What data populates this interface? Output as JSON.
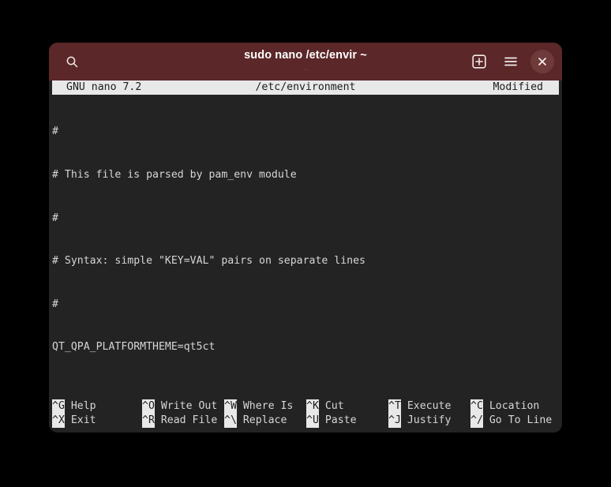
{
  "window": {
    "titlebar": {
      "search_icon": "search-icon",
      "title": "sudo nano /etc/envir ~",
      "subtitle": "~",
      "new_tab_icon": "new-tab-icon",
      "menu_icon": "hamburger-menu-icon",
      "close_icon": "close-icon"
    },
    "colors": {
      "titlebar_bg": "#5b2728",
      "terminal_bg": "#232323",
      "terminal_fg": "#d6d6d6",
      "reverse_bg": "#e8e8e8",
      "reverse_fg": "#1c1c1c",
      "page_bg": "#000000",
      "close_btn_bg": "#6f3a3a"
    }
  },
  "nano": {
    "status_bar": {
      "version": "GNU nano 7.2",
      "filename": "/etc/environment",
      "state": "Modified"
    },
    "buffer": [
      "#",
      "# This file is parsed by pam_env module",
      "#",
      "# Syntax: simple \"KEY=VAL\" pairs on separate lines",
      "#",
      "QT_QPA_PLATFORMTHEME=qt5ct"
    ],
    "shortcuts": {
      "row1": [
        {
          "key": "^G",
          "label": "Help"
        },
        {
          "key": "^O",
          "label": "Write Out"
        },
        {
          "key": "^W",
          "label": "Where Is"
        },
        {
          "key": "^K",
          "label": "Cut"
        },
        {
          "key": "^T",
          "label": "Execute"
        },
        {
          "key": "^C",
          "label": "Location"
        }
      ],
      "row2": [
        {
          "key": "^X",
          "label": "Exit"
        },
        {
          "key": "^R",
          "label": "Read File"
        },
        {
          "key": "^\\",
          "label": "Replace"
        },
        {
          "key": "^U",
          "label": "Paste"
        },
        {
          "key": "^J",
          "label": "Justify"
        },
        {
          "key": "^/",
          "label": "Go To Line"
        }
      ]
    }
  }
}
